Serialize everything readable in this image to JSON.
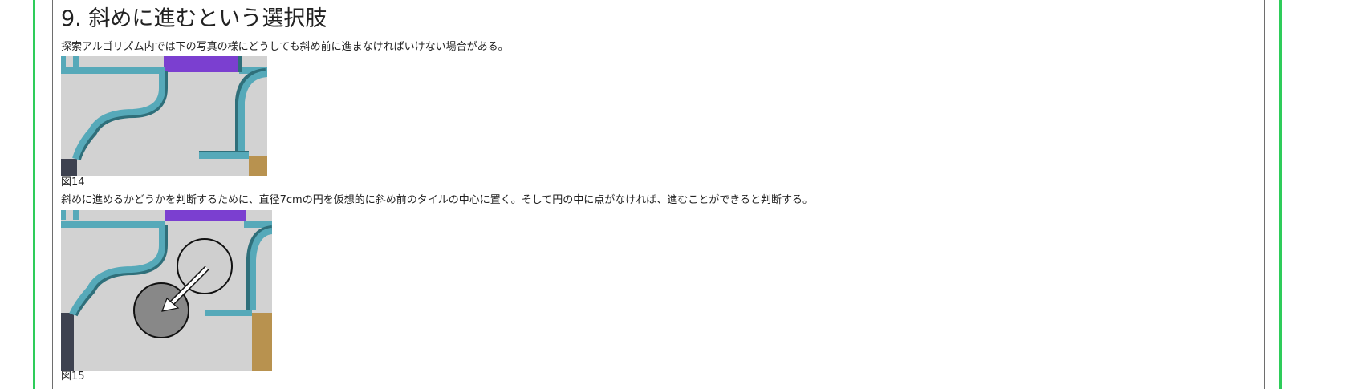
{
  "section": {
    "title": "9. 斜めに進むという選択肢",
    "intro": "探索アルゴリズム内では下の写真の様にどうしても斜め前に進まなければいけない場合がある。",
    "figure14_caption": "図14",
    "explanation": "斜めに進めるかどうかを判断するために、直径7cmの円を仮想的に斜め前のタイルの中心に置く。そして円の中に点がなければ、進むことができると判断する。",
    "figure15_caption": "図15"
  },
  "colors": {
    "accent_border": "#2ecc5a",
    "tile_floor": "#d2d2d2",
    "wall": "#56a9b9",
    "wall_shadow": "#2f6f7a",
    "purple_tile": "#7b3fd0",
    "dark_tile": "#3e4250",
    "gold_tile": "#b8924f",
    "circle_fill_current": "#888888",
    "circle_fill_target": "#cfcfcf"
  }
}
